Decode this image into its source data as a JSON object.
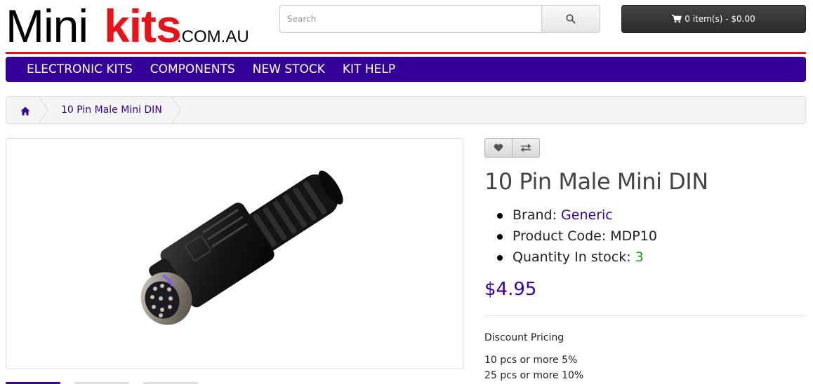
{
  "logo": {
    "part1": "Mini",
    "part2": "kits",
    "domain": ".COM.AU"
  },
  "search": {
    "placeholder": "Search",
    "icon": "search-icon"
  },
  "cart": {
    "label": "0 item(s) - $0.00",
    "icon": "shopping-cart-icon"
  },
  "menu": {
    "items": [
      {
        "label": "ELECTRONIC KITS"
      },
      {
        "label": "COMPONENTS"
      },
      {
        "label": "NEW STOCK"
      },
      {
        "label": "KIT HELP"
      }
    ]
  },
  "breadcrumb": {
    "home_icon": "home-icon",
    "current": "10 Pin Male Mini DIN"
  },
  "actions": {
    "wishlist_icon": "heart-icon",
    "compare_icon": "exchange-icon"
  },
  "product": {
    "title": "10 Pin Male Mini DIN",
    "brand_label": "Brand:",
    "brand_value": "Generic",
    "code_label": "Product Code:",
    "code_value": "MDP10",
    "stock_label": "Quantity In stock:",
    "stock_value": "3",
    "price": "$4.95"
  },
  "discount": {
    "title": "Discount Pricing",
    "tiers": [
      "10 pcs or more 5%",
      "25 pcs or more 10%"
    ]
  },
  "colors": {
    "brand": "#330099",
    "accent_red": "#e8121a",
    "in_stock": "#1a9e1a"
  }
}
